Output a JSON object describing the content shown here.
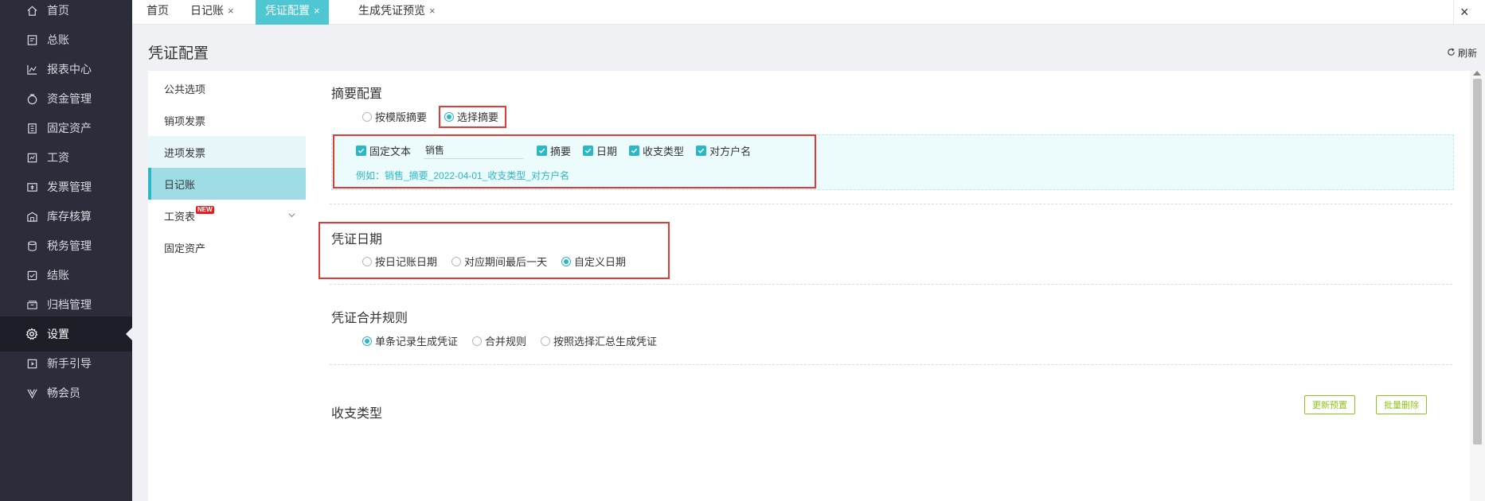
{
  "sidenav": {
    "items": [
      {
        "label": "首页",
        "icon": "home-icon"
      },
      {
        "label": "总账",
        "icon": "ledger-icon"
      },
      {
        "label": "报表中心",
        "icon": "chart-icon"
      },
      {
        "label": "资金管理",
        "icon": "money-bag-icon"
      },
      {
        "label": "固定资产",
        "icon": "building-icon"
      },
      {
        "label": "工资",
        "icon": "salary-icon"
      },
      {
        "label": "发票管理",
        "icon": "invoice-icon"
      },
      {
        "label": "库存核算",
        "icon": "warehouse-icon"
      },
      {
        "label": "税务管理",
        "icon": "tax-icon"
      },
      {
        "label": "结账",
        "icon": "checkout-icon"
      },
      {
        "label": "归档管理",
        "icon": "archive-icon"
      },
      {
        "label": "设置",
        "icon": "gear-icon"
      },
      {
        "label": "新手引导",
        "icon": "guide-icon"
      },
      {
        "label": "畅会员",
        "icon": "vip-icon"
      }
    ],
    "active_index": 11
  },
  "tabs": [
    {
      "label": "首页",
      "closable": false
    },
    {
      "label": "日记账",
      "closable": true
    },
    {
      "label": "凭证配置",
      "closable": true,
      "active": true
    },
    {
      "label": "生成凭证预览",
      "closable": true
    }
  ],
  "close_all": "×",
  "close_symbol": "×",
  "page": {
    "title": "凭证配置",
    "refresh_label": "刷新"
  },
  "submenu": {
    "items": [
      {
        "label": "公共选项"
      },
      {
        "label": "销项发票"
      },
      {
        "label": "进项发票"
      },
      {
        "label": "日记账"
      },
      {
        "label": "工资表",
        "badge": "NEW"
      },
      {
        "label": "固定资产"
      }
    ]
  },
  "summary_config": {
    "title": "摘要配置",
    "options": [
      "按模版摘要",
      "选择摘要"
    ],
    "selected": 1,
    "fixed_text_label": "固定文本",
    "fixed_text_value": "销售",
    "checks": [
      "摘要",
      "日期",
      "收支类型",
      "对方户名"
    ],
    "example": "例如：销售_摘要_2022-04-01_收支类型_对方户名"
  },
  "voucher_date": {
    "title": "凭证日期",
    "options": [
      "按日记账日期",
      "对应期间最后一天",
      "自定义日期"
    ],
    "selected": 2
  },
  "merge_rule": {
    "title": "凭证合并规则",
    "options": [
      "单条记录生成凭证",
      "合并规则",
      "按照选择汇总生成凭证"
    ],
    "selected": 0
  },
  "income_type": {
    "title": "收支类型",
    "update_preset_label": "更新预置",
    "batch_delete_label": "批量删除"
  },
  "colors": {
    "accent": "#2bb7c6",
    "highlight": "#e53935",
    "sidebar": "#2b2d3b",
    "button_green": "#8fc31f"
  }
}
